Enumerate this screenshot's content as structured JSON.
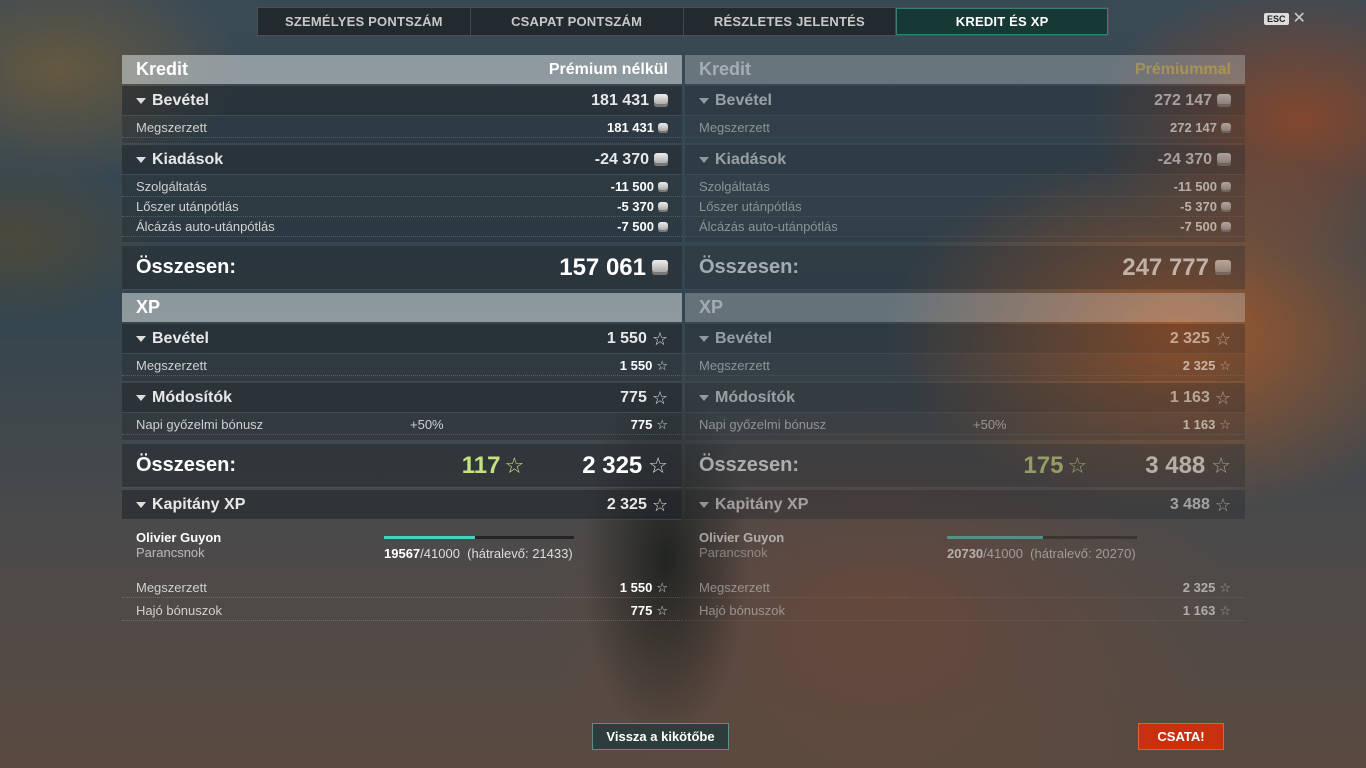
{
  "tabs": [
    "SZEMÉLYES PONTSZÁM",
    "CSAPAT PONTSZÁM",
    "RÉSZLETES JELENTÉS",
    "KREDIT ÉS XP"
  ],
  "esc": "ESC",
  "columns": [
    {
      "credit_title": "Kredit",
      "credit_sub": "Prémium nélkül",
      "income_label": "Bevétel",
      "income_value": "181 431",
      "earned_label": "Megszerzett",
      "earned_value": "181 431",
      "expenses_label": "Kiadások",
      "expenses_value": "-24 370",
      "service_label": "Szolgáltatás",
      "service_value": "-11 500",
      "ammo_label": "Lőszer utánpótlás",
      "ammo_value": "-5 370",
      "camo_label": "Álcázás auto-utánpótlás",
      "camo_value": "-7 500",
      "total_label": "Összesen:",
      "credit_total": "157 061",
      "xp_title": "XP",
      "xp_income_label": "Bevétel",
      "xp_income_value": "1 550",
      "xp_earned_label": "Megszerzett",
      "xp_earned_value": "1 550",
      "mod_label": "Módosítók",
      "mod_value": "775",
      "daily_label": "Napi győzelmi bónusz",
      "daily_pct": "+50%",
      "daily_value": "775",
      "xp_total_label": "Összesen:",
      "xp_free": "117",
      "xp_total": "2 325",
      "captain_label": "Kapitány XP",
      "captain_value": "2 325",
      "captain_name": "Olivier Guyon",
      "captain_rank": "Parancsnok",
      "cap_current": "19567",
      "cap_max": "/41000",
      "cap_remaining": "(hátralevő: 21433)",
      "cap_progress": 0.477,
      "cap_earned_label": "Megszerzett",
      "cap_earned_value": "1 550",
      "cap_ship_label": "Hajó bónuszok",
      "cap_ship_value": "775"
    },
    {
      "credit_title": "Kredit",
      "credit_sub": "Prémiummal",
      "income_label": "Bevétel",
      "income_value": "272 147",
      "earned_label": "Megszerzett",
      "earned_value": "272 147",
      "expenses_label": "Kiadások",
      "expenses_value": "-24 370",
      "service_label": "Szolgáltatás",
      "service_value": "-11 500",
      "ammo_label": "Lőszer utánpótlás",
      "ammo_value": "-5 370",
      "camo_label": "Álcázás auto-utánpótlás",
      "camo_value": "-7 500",
      "total_label": "Összesen:",
      "credit_total": "247 777",
      "xp_title": "XP",
      "xp_income_label": "Bevétel",
      "xp_income_value": "2 325",
      "xp_earned_label": "Megszerzett",
      "xp_earned_value": "2 325",
      "mod_label": "Módosítók",
      "mod_value": "1 163",
      "daily_label": "Napi győzelmi bónusz",
      "daily_pct": "+50%",
      "daily_value": "1 163",
      "xp_total_label": "Összesen:",
      "xp_free": "175",
      "xp_total": "3 488",
      "captain_label": "Kapitány XP",
      "captain_value": "3 488",
      "captain_name": "Olivier Guyon",
      "captain_rank": "Parancsnok",
      "cap_current": "20730",
      "cap_max": "/41000",
      "cap_remaining": "(hátralevő: 20270)",
      "cap_progress": 0.506,
      "cap_earned_label": "Megszerzett",
      "cap_earned_value": "2 325",
      "cap_ship_label": "Hajó bónuszok",
      "cap_ship_value": "1 163"
    }
  ],
  "buttons": {
    "back": "Vissza a kikötőbe",
    "battle": "CSATA!"
  },
  "colors": {
    "accent_teal": "#4ad0c0",
    "battle_red": "#c83010",
    "premium_gold": "#f0d060",
    "free_xp_green": "#c8e080"
  }
}
